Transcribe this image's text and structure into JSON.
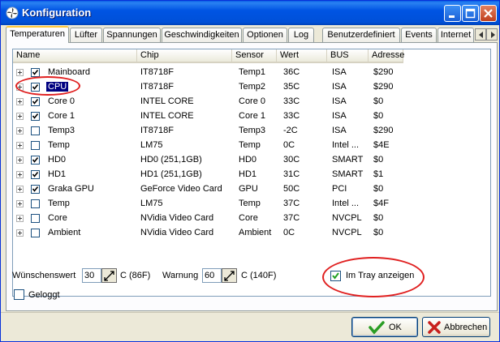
{
  "window": {
    "title": "Konfiguration"
  },
  "tabs": [
    "Temperaturen",
    "Lüfter",
    "Spannungen",
    "Geschwindigkeiten",
    "Optionen",
    "Log",
    "Benutzerdefiniert",
    "Events",
    "Internet"
  ],
  "table": {
    "columns": [
      "Name",
      "Chip",
      "Sensor",
      "Wert",
      "BUS",
      "Adresse"
    ],
    "rows": [
      {
        "checked": true,
        "name": "Mainboard",
        "chip": "IT8718F",
        "sensor": "Temp1",
        "value": "36C",
        "bus": "ISA",
        "address": "$290"
      },
      {
        "checked": true,
        "name": "CPU",
        "chip": "IT8718F",
        "sensor": "Temp2",
        "value": "35C",
        "bus": "ISA",
        "address": "$290",
        "selected": true
      },
      {
        "checked": true,
        "name": "Core 0",
        "chip": "INTEL CORE",
        "sensor": "Core 0",
        "value": "33C",
        "bus": "ISA",
        "address": "$0"
      },
      {
        "checked": true,
        "name": "Core 1",
        "chip": "INTEL CORE",
        "sensor": "Core 1",
        "value": "33C",
        "bus": "ISA",
        "address": "$0"
      },
      {
        "checked": false,
        "name": "Temp3",
        "chip": "IT8718F",
        "sensor": "Temp3",
        "value": "-2C",
        "bus": "ISA",
        "address": "$290"
      },
      {
        "checked": false,
        "name": "Temp",
        "chip": "LM75",
        "sensor": "Temp",
        "value": "0C",
        "bus": "Intel ...",
        "address": "$4E"
      },
      {
        "checked": true,
        "name": "HD0",
        "chip": "HD0 (251,1GB)",
        "sensor": "HD0",
        "value": "30C",
        "bus": "SMART",
        "address": "$0"
      },
      {
        "checked": true,
        "name": "HD1",
        "chip": "HD1 (251,1GB)",
        "sensor": "HD1",
        "value": "31C",
        "bus": "SMART",
        "address": "$1"
      },
      {
        "checked": true,
        "name": "Graka GPU",
        "chip": "GeForce Video Card",
        "sensor": "GPU",
        "value": "50C",
        "bus": "PCI",
        "address": "$0"
      },
      {
        "checked": false,
        "name": "Temp",
        "chip": "LM75",
        "sensor": "Temp",
        "value": "37C",
        "bus": "Intel ...",
        "address": "$4F"
      },
      {
        "checked": false,
        "name": "Core",
        "chip": "NVidia Video Card",
        "sensor": "Core",
        "value": "37C",
        "bus": "NVCPL",
        "address": "$0"
      },
      {
        "checked": false,
        "name": "Ambient",
        "chip": "NVidia Video Card",
        "sensor": "Ambient",
        "value": "0C",
        "bus": "NVCPL",
        "address": "$0"
      }
    ]
  },
  "controls": {
    "desired_label": "Wünschenswert",
    "desired_value": "30",
    "desired_unit": "C (86F)",
    "warning_label": "Warnung",
    "warning_value": "60",
    "warning_unit": "C (140F)",
    "tray_label": "Im Tray anzeigen",
    "tray_checked": true,
    "logged_label": "Geloggt",
    "logged_checked": false
  },
  "buttons": {
    "ok": "OK",
    "cancel": "Abbrechen"
  },
  "colors": {
    "annotation": "#e02020",
    "selection": "#000080",
    "ok_check": "#2a9d24",
    "cancel_x": "#c8201c"
  }
}
